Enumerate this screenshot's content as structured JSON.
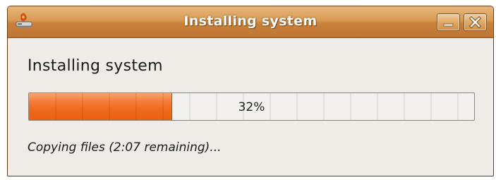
{
  "window": {
    "title": "Installing system"
  },
  "titlebar_buttons": {
    "minimize_icon": "minimize-icon",
    "close_icon": "close-icon"
  },
  "app_icon": "installer-icon",
  "main": {
    "heading": "Installing system",
    "progress": {
      "value_percent": 32,
      "label": "32%"
    },
    "status": "Copying files (2:07 remaining)..."
  },
  "colors": {
    "titlebar": "#d38f46",
    "progress_fill": "#ef6a1e",
    "window_bg": "#efebe7"
  }
}
